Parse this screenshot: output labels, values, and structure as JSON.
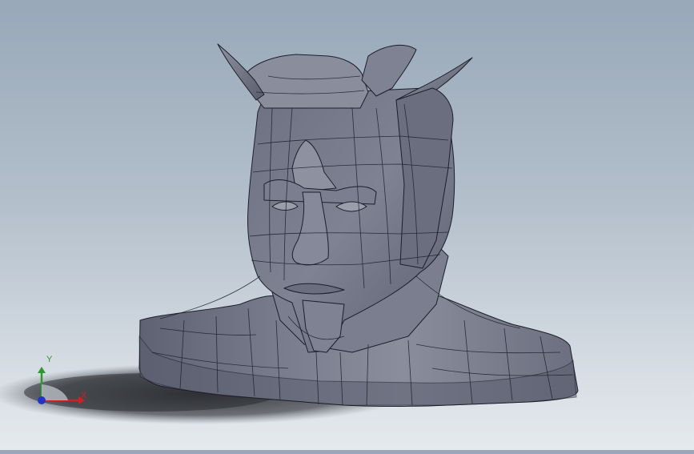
{
  "viewport": {
    "background_top": "#98a8b8",
    "background_bottom": "#e6eaee"
  },
  "model": {
    "body_color": "#6c7080",
    "edge_color": "#1c1f2a"
  },
  "triad": {
    "x_label": "X",
    "y_label": "Y",
    "x_color": "#cc2222",
    "y_color": "#2a9a2a",
    "z_color": "#2233cc"
  }
}
